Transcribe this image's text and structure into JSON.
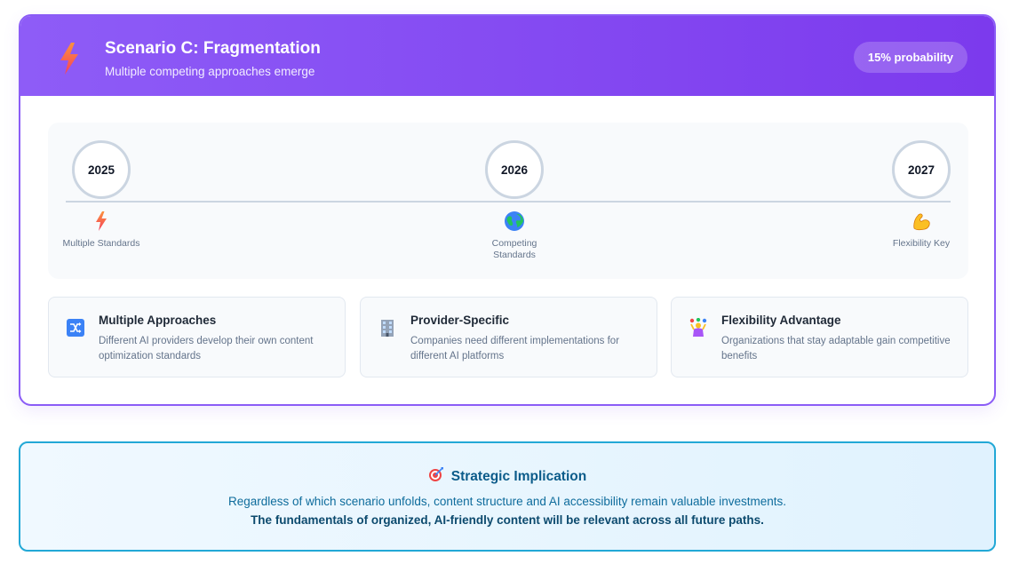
{
  "scenario": {
    "icon": "lightning-bolt-icon",
    "title": "Scenario C: Fragmentation",
    "subtitle": "Multiple competing approaches emerge",
    "probability": "15% probability",
    "accent_color": "#8b5cf6"
  },
  "timeline": {
    "milestones": [
      {
        "year": "2025",
        "icon": "lightning-bolt-icon",
        "label": "Multiple Standards"
      },
      {
        "year": "2026",
        "icon": "globe-icon",
        "label": "Competing Standards"
      },
      {
        "year": "2027",
        "icon": "flexed-biceps-icon",
        "label": "Flexibility Key"
      }
    ]
  },
  "features": [
    {
      "icon": "shuffle-icon",
      "title": "Multiple Approaches",
      "description": "Different AI providers develop their own content optimization standards"
    },
    {
      "icon": "office-building-icon",
      "title": "Provider-Specific",
      "description": "Companies need different implementations for different AI platforms"
    },
    {
      "icon": "juggler-icon",
      "title": "Flexibility Advantage",
      "description": "Organizations that stay adaptable gain competitive benefits"
    }
  ],
  "implication": {
    "icon": "target-icon",
    "title": "Strategic Implication",
    "text": "Regardless of which scenario unfolds, content structure and AI accessibility remain valuable investments.",
    "emphasis": "The fundamentals of organized, AI-friendly content will be relevant across all future paths.",
    "accent_color": "#22a8d6"
  }
}
